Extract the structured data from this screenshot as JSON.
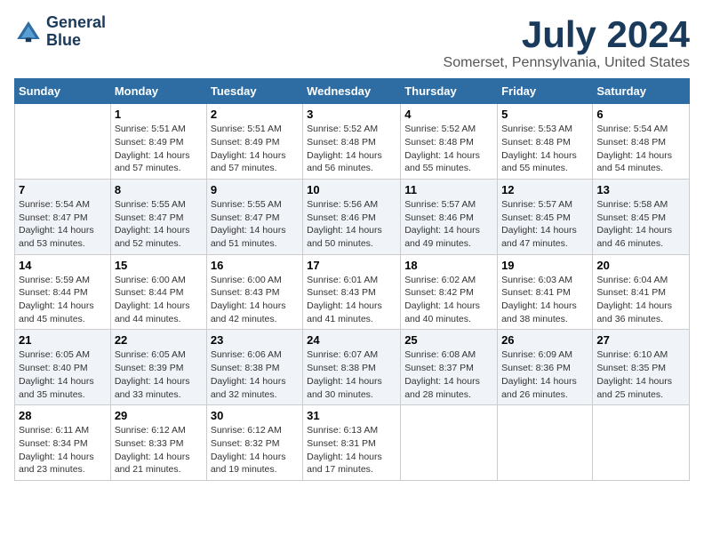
{
  "header": {
    "logo_line1": "General",
    "logo_line2": "Blue",
    "main_title": "July 2024",
    "subtitle": "Somerset, Pennsylvania, United States"
  },
  "calendar": {
    "days_of_week": [
      "Sunday",
      "Monday",
      "Tuesday",
      "Wednesday",
      "Thursday",
      "Friday",
      "Saturday"
    ],
    "weeks": [
      [
        {
          "day": "",
          "info": ""
        },
        {
          "day": "1",
          "info": "Sunrise: 5:51 AM\nSunset: 8:49 PM\nDaylight: 14 hours\nand 57 minutes."
        },
        {
          "day": "2",
          "info": "Sunrise: 5:51 AM\nSunset: 8:49 PM\nDaylight: 14 hours\nand 57 minutes."
        },
        {
          "day": "3",
          "info": "Sunrise: 5:52 AM\nSunset: 8:48 PM\nDaylight: 14 hours\nand 56 minutes."
        },
        {
          "day": "4",
          "info": "Sunrise: 5:52 AM\nSunset: 8:48 PM\nDaylight: 14 hours\nand 55 minutes."
        },
        {
          "day": "5",
          "info": "Sunrise: 5:53 AM\nSunset: 8:48 PM\nDaylight: 14 hours\nand 55 minutes."
        },
        {
          "day": "6",
          "info": "Sunrise: 5:54 AM\nSunset: 8:48 PM\nDaylight: 14 hours\nand 54 minutes."
        }
      ],
      [
        {
          "day": "7",
          "info": "Sunrise: 5:54 AM\nSunset: 8:47 PM\nDaylight: 14 hours\nand 53 minutes."
        },
        {
          "day": "8",
          "info": "Sunrise: 5:55 AM\nSunset: 8:47 PM\nDaylight: 14 hours\nand 52 minutes."
        },
        {
          "day": "9",
          "info": "Sunrise: 5:55 AM\nSunset: 8:47 PM\nDaylight: 14 hours\nand 51 minutes."
        },
        {
          "day": "10",
          "info": "Sunrise: 5:56 AM\nSunset: 8:46 PM\nDaylight: 14 hours\nand 50 minutes."
        },
        {
          "day": "11",
          "info": "Sunrise: 5:57 AM\nSunset: 8:46 PM\nDaylight: 14 hours\nand 49 minutes."
        },
        {
          "day": "12",
          "info": "Sunrise: 5:57 AM\nSunset: 8:45 PM\nDaylight: 14 hours\nand 47 minutes."
        },
        {
          "day": "13",
          "info": "Sunrise: 5:58 AM\nSunset: 8:45 PM\nDaylight: 14 hours\nand 46 minutes."
        }
      ],
      [
        {
          "day": "14",
          "info": "Sunrise: 5:59 AM\nSunset: 8:44 PM\nDaylight: 14 hours\nand 45 minutes."
        },
        {
          "day": "15",
          "info": "Sunrise: 6:00 AM\nSunset: 8:44 PM\nDaylight: 14 hours\nand 44 minutes."
        },
        {
          "day": "16",
          "info": "Sunrise: 6:00 AM\nSunset: 8:43 PM\nDaylight: 14 hours\nand 42 minutes."
        },
        {
          "day": "17",
          "info": "Sunrise: 6:01 AM\nSunset: 8:43 PM\nDaylight: 14 hours\nand 41 minutes."
        },
        {
          "day": "18",
          "info": "Sunrise: 6:02 AM\nSunset: 8:42 PM\nDaylight: 14 hours\nand 40 minutes."
        },
        {
          "day": "19",
          "info": "Sunrise: 6:03 AM\nSunset: 8:41 PM\nDaylight: 14 hours\nand 38 minutes."
        },
        {
          "day": "20",
          "info": "Sunrise: 6:04 AM\nSunset: 8:41 PM\nDaylight: 14 hours\nand 36 minutes."
        }
      ],
      [
        {
          "day": "21",
          "info": "Sunrise: 6:05 AM\nSunset: 8:40 PM\nDaylight: 14 hours\nand 35 minutes."
        },
        {
          "day": "22",
          "info": "Sunrise: 6:05 AM\nSunset: 8:39 PM\nDaylight: 14 hours\nand 33 minutes."
        },
        {
          "day": "23",
          "info": "Sunrise: 6:06 AM\nSunset: 8:38 PM\nDaylight: 14 hours\nand 32 minutes."
        },
        {
          "day": "24",
          "info": "Sunrise: 6:07 AM\nSunset: 8:38 PM\nDaylight: 14 hours\nand 30 minutes."
        },
        {
          "day": "25",
          "info": "Sunrise: 6:08 AM\nSunset: 8:37 PM\nDaylight: 14 hours\nand 28 minutes."
        },
        {
          "day": "26",
          "info": "Sunrise: 6:09 AM\nSunset: 8:36 PM\nDaylight: 14 hours\nand 26 minutes."
        },
        {
          "day": "27",
          "info": "Sunrise: 6:10 AM\nSunset: 8:35 PM\nDaylight: 14 hours\nand 25 minutes."
        }
      ],
      [
        {
          "day": "28",
          "info": "Sunrise: 6:11 AM\nSunset: 8:34 PM\nDaylight: 14 hours\nand 23 minutes."
        },
        {
          "day": "29",
          "info": "Sunrise: 6:12 AM\nSunset: 8:33 PM\nDaylight: 14 hours\nand 21 minutes."
        },
        {
          "day": "30",
          "info": "Sunrise: 6:12 AM\nSunset: 8:32 PM\nDaylight: 14 hours\nand 19 minutes."
        },
        {
          "day": "31",
          "info": "Sunrise: 6:13 AM\nSunset: 8:31 PM\nDaylight: 14 hours\nand 17 minutes."
        },
        {
          "day": "",
          "info": ""
        },
        {
          "day": "",
          "info": ""
        },
        {
          "day": "",
          "info": ""
        }
      ]
    ]
  }
}
